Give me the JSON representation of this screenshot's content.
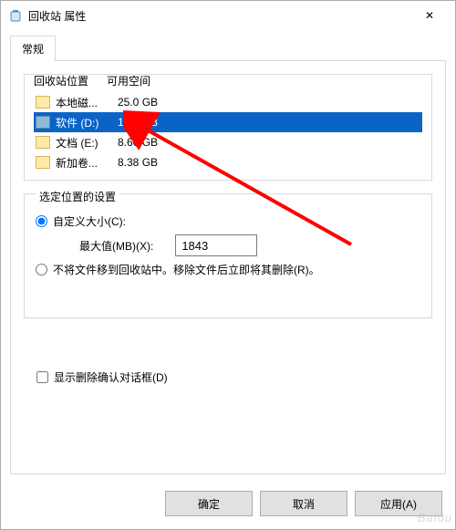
{
  "window": {
    "title": "回收站 属性",
    "close_glyph": "✕"
  },
  "tabs": {
    "general": "常规"
  },
  "location_group": {
    "col_location": "回收站位置",
    "col_space": "可用空间",
    "drives": [
      {
        "name": "本地磁...",
        "space": "25.0 GB",
        "selected": false
      },
      {
        "name": "软件 (D:)",
        "space": "18.0 GB",
        "selected": true
      },
      {
        "name": "文档 (E:)",
        "space": "8.60 GB",
        "selected": false
      },
      {
        "name": "新加卷...",
        "space": "8.38 GB",
        "selected": false
      }
    ]
  },
  "settings_group": {
    "legend": "选定位置的设置",
    "radio_custom": "自定义大小(C):",
    "max_label": "最大值(MB)(X):",
    "max_value": "1843",
    "radio_dontmove": "不将文件移到回收站中。移除文件后立即将其删除(R)。"
  },
  "confirm_checkbox": "显示删除确认对话框(D)",
  "buttons": {
    "ok": "确定",
    "cancel": "取消",
    "apply": "应用(A)"
  },
  "watermark": "Baidu"
}
